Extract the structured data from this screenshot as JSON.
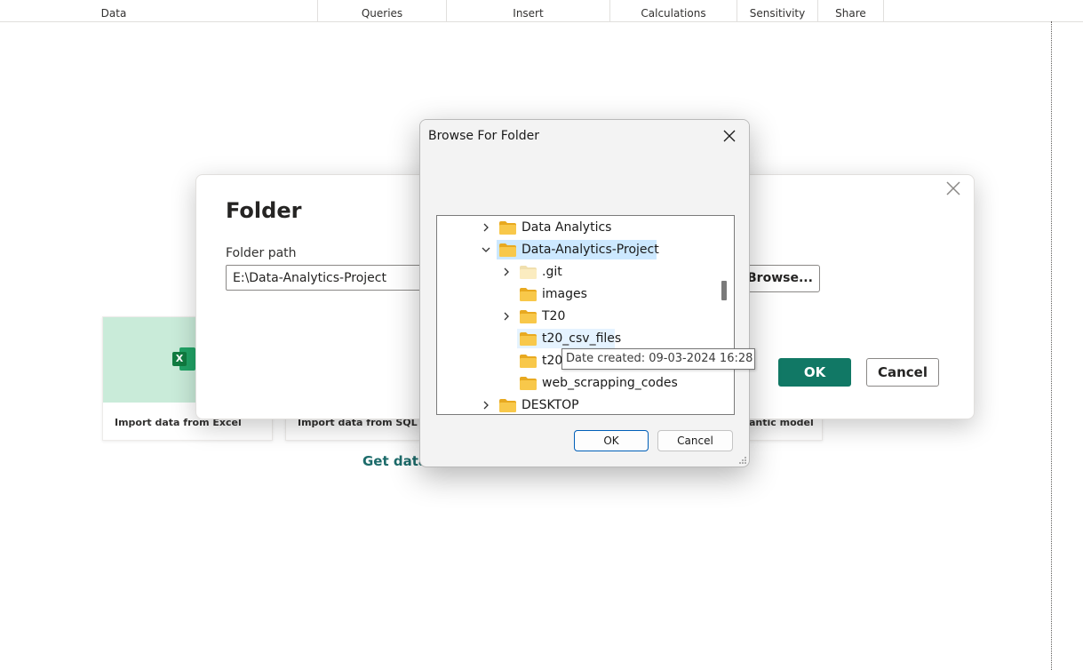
{
  "ribbon": {
    "groups": [
      "Data",
      "Queries",
      "Insert",
      "Calculations",
      "Sensitivity",
      "Share"
    ]
  },
  "background": {
    "cards": [
      "Import data from Excel",
      "Import data from SQL Se",
      "antic model"
    ],
    "excel_glyph": "X",
    "get_data_text": "Get data"
  },
  "folder_dialog": {
    "title": "Folder",
    "path_label": "Folder path",
    "path_value": "E:\\Data-Analytics-Project",
    "browse_label": "Browse...",
    "ok_label": "OK",
    "cancel_label": "Cancel"
  },
  "browse_dialog": {
    "title": "Browse For Folder",
    "tree": [
      {
        "name": "Data Analytics",
        "expander": "collapsed"
      },
      {
        "name": "Data-Analytics-Project",
        "expander": "expanded",
        "selected": true
      },
      {
        "name": ".git",
        "expander": "collapsed",
        "hidden_folder": true
      },
      {
        "name": "images",
        "expander": "none"
      },
      {
        "name": "T20",
        "expander": "collapsed"
      },
      {
        "name": "t20_csv_files",
        "expander": "none",
        "hover": true
      },
      {
        "name": "t20",
        "expander": "none"
      },
      {
        "name": "web_scrapping_codes",
        "expander": "none"
      },
      {
        "name": "DESKTOP",
        "expander": "collapsed"
      }
    ],
    "ok_label": "OK",
    "cancel_label": "Cancel"
  },
  "tooltip": {
    "text": "Date created: 09-03-2024 16:28"
  },
  "colors": {
    "primary_button": "#117865",
    "selection": "#cce8ff",
    "folder_yellow": "#f8c84a",
    "excel_green": "#107c41",
    "link_teal": "#1c6b6a"
  }
}
